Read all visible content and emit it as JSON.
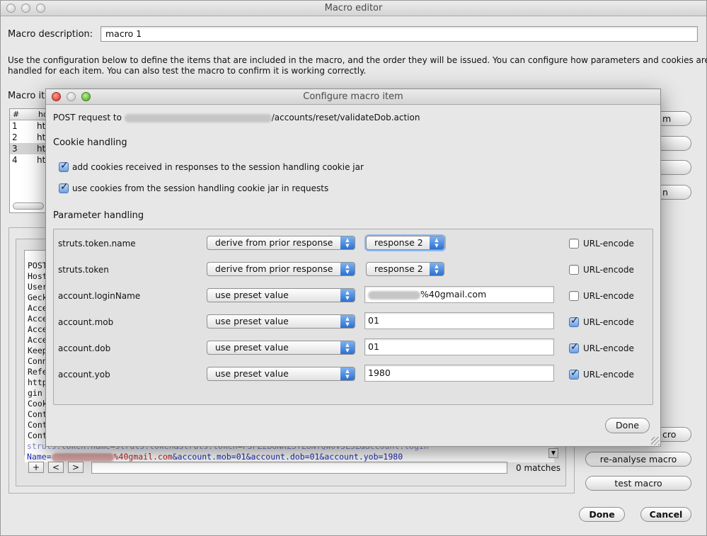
{
  "main": {
    "title": "Macro editor",
    "description_label": "Macro description:",
    "description_value": "macro 1",
    "help_text_1": "Use the configuration below to define the items that are included in the macro, and the order they will be issued. You can configure how parameters and cookies are",
    "help_text_2": "handled for each item. You can also test the macro to confirm it is working correctly.",
    "items_label": "Macro ite",
    "table": {
      "col1": "#",
      "col2": "ho",
      "rows": [
        {
          "num": "1",
          "host": "htt"
        },
        {
          "num": "2",
          "host": "htt"
        },
        {
          "num": "3",
          "host": "htt"
        },
        {
          "num": "4",
          "host": "htt"
        }
      ]
    },
    "side_buttons": [
      "m",
      "",
      "",
      "n"
    ],
    "request_lines": [
      "POST",
      "Host",
      "User",
      "Geck",
      "Acce",
      "Acce",
      "Acce",
      "Acce",
      "Keep",
      "Conn",
      "Refe",
      "http",
      "gin",
      "Cook",
      "Cont",
      "Cont",
      "Cont"
    ],
    "request_bottom_1": "struts.token.name=struts.token&struts.token=F3FZ2BGNKZSTZ8NTQW0V5L5Z&account.login",
    "request_bottom_2a": "Name=",
    "request_bottom_2b": "%40gmail.com",
    "request_bottom_2c": "&account.mob=01&account.dob=01&account.yob=1980",
    "search_buttons": [
      "+",
      "<",
      ">"
    ],
    "matches": "0 matches",
    "btn_macro_partial": "cro",
    "btn_reanalyse": "re-analyse macro",
    "btn_test": "test macro",
    "btn_done": "Done",
    "btn_cancel": "Cancel"
  },
  "dialog": {
    "title": "Configure macro item",
    "request_prefix": "POST request to",
    "request_suffix": "/accounts/reset/validateDob.action",
    "cookie_heading": "Cookie handling",
    "cookie_options": [
      {
        "label": "add cookies received in responses to the session handling cookie jar",
        "checked": true
      },
      {
        "label": "use cookies from the session handling cookie jar in requests",
        "checked": true
      }
    ],
    "param_heading": "Parameter handling",
    "params": [
      {
        "name": "struts.token.name",
        "mode": "derive from prior response",
        "value": "response 2",
        "kind": "select",
        "focus": true,
        "url_encode": false
      },
      {
        "name": "struts.token",
        "mode": "derive from prior response",
        "value": "response 2",
        "kind": "select",
        "focus": false,
        "url_encode": false
      },
      {
        "name": "account.loginName",
        "mode": "use preset value",
        "value": "%40gmail.com",
        "kind": "text-blurred",
        "focus": false,
        "url_encode": false
      },
      {
        "name": "account.mob",
        "mode": "use preset value",
        "value": "01",
        "kind": "text",
        "focus": false,
        "url_encode": true
      },
      {
        "name": "account.dob",
        "mode": "use preset value",
        "value": "01",
        "kind": "text",
        "focus": false,
        "url_encode": true
      },
      {
        "name": "account.yob",
        "mode": "use preset value",
        "value": "1980",
        "kind": "text",
        "focus": false,
        "url_encode": true
      }
    ],
    "url_encode_label": "URL-encode",
    "done_label": "Done"
  },
  "colors": {
    "accent_blue": "#2d6fcf",
    "checkbox_fill": "#6e9fe0",
    "close_red": "#d52b1f",
    "zoom_green": "#45a21a",
    "url_text_blue": "#1f2ab5",
    "url_text_red": "#b51f1f"
  }
}
